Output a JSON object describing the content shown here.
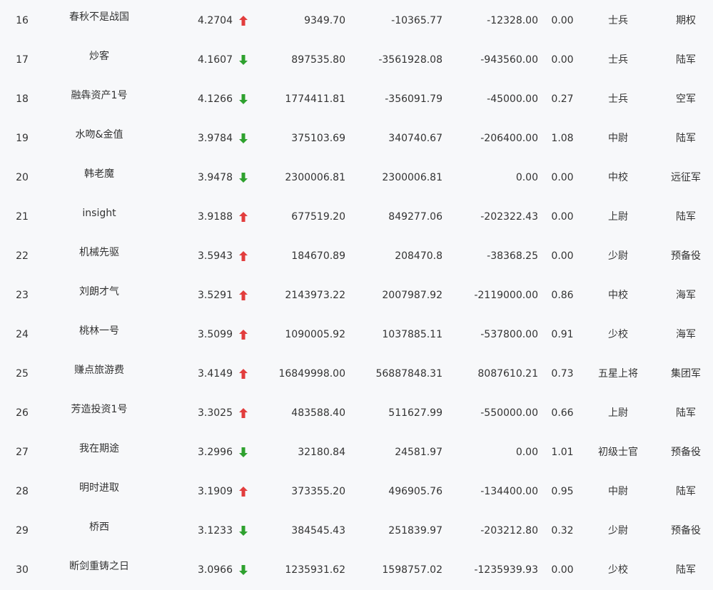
{
  "colors": {
    "up": "#e23d3d",
    "down": "#2ea12e"
  },
  "rows": [
    {
      "rank": "16",
      "name": "春秋不是战国",
      "score": "4.2704",
      "trend": "up",
      "v1": "9349.70",
      "v2": "-10365.77",
      "v3": "-12328.00",
      "v4": "0.00",
      "level": "士兵",
      "group": "期权"
    },
    {
      "rank": "17",
      "name": "炒客",
      "score": "4.1607",
      "trend": "down",
      "v1": "897535.80",
      "v2": "-3561928.08",
      "v3": "-943560.00",
      "v4": "0.00",
      "level": "士兵",
      "group": "陆军"
    },
    {
      "rank": "18",
      "name": "融犇资产1号",
      "score": "4.1266",
      "trend": "down",
      "v1": "1774411.81",
      "v2": "-356091.79",
      "v3": "-45000.00",
      "v4": "0.27",
      "level": "士兵",
      "group": "空军"
    },
    {
      "rank": "19",
      "name": "水吻&金值",
      "score": "3.9784",
      "trend": "down",
      "v1": "375103.69",
      "v2": "340740.67",
      "v3": "-206400.00",
      "v4": "1.08",
      "level": "中尉",
      "group": "陆军"
    },
    {
      "rank": "20",
      "name": "韩老魔",
      "score": "3.9478",
      "trend": "down",
      "v1": "2300006.81",
      "v2": "2300006.81",
      "v3": "0.00",
      "v4": "0.00",
      "level": "中校",
      "group": "远征军"
    },
    {
      "rank": "21",
      "name": "insight",
      "score": "3.9188",
      "trend": "up",
      "v1": "677519.20",
      "v2": "849277.06",
      "v3": "-202322.43",
      "v4": "0.00",
      "level": "上尉",
      "group": "陆军"
    },
    {
      "rank": "22",
      "name": "机械先驱",
      "score": "3.5943",
      "trend": "up",
      "v1": "184670.89",
      "v2": "208470.8",
      "v3": "-38368.25",
      "v4": "0.00",
      "level": "少尉",
      "group": "预备役"
    },
    {
      "rank": "23",
      "name": "刘朗才气",
      "score": "3.5291",
      "trend": "up",
      "v1": "2143973.22",
      "v2": "2007987.92",
      "v3": "-2119000.00",
      "v4": "0.86",
      "level": "中校",
      "group": "海军"
    },
    {
      "rank": "24",
      "name": "桃林一号",
      "score": "3.5099",
      "trend": "up",
      "v1": "1090005.92",
      "v2": "1037885.11",
      "v3": "-537800.00",
      "v4": "0.91",
      "level": "少校",
      "group": "海军"
    },
    {
      "rank": "25",
      "name": "赚点旅游费",
      "score": "3.4149",
      "trend": "up",
      "v1": "16849998.00",
      "v2": "56887848.31",
      "v3": "8087610.21",
      "v4": "0.73",
      "level": "五星上将",
      "group": "集团军"
    },
    {
      "rank": "26",
      "name": "芳造投资1号",
      "score": "3.3025",
      "trend": "up",
      "v1": "483588.40",
      "v2": "511627.99",
      "v3": "-550000.00",
      "v4": "0.66",
      "level": "上尉",
      "group": "陆军"
    },
    {
      "rank": "27",
      "name": "我在期途",
      "score": "3.2996",
      "trend": "down",
      "v1": "32180.84",
      "v2": "24581.97",
      "v3": "0.00",
      "v4": "1.01",
      "level": "初级士官",
      "group": "预备役"
    },
    {
      "rank": "28",
      "name": "明时进取",
      "score": "3.1909",
      "trend": "up",
      "v1": "373355.20",
      "v2": "496905.76",
      "v3": "-134400.00",
      "v4": "0.95",
      "level": "中尉",
      "group": "陆军"
    },
    {
      "rank": "29",
      "name": "桥西",
      "score": "3.1233",
      "trend": "down",
      "v1": "384545.43",
      "v2": "251839.97",
      "v3": "-203212.80",
      "v4": "0.32",
      "level": "少尉",
      "group": "预备役"
    },
    {
      "rank": "30",
      "name": "断剑重铸之日",
      "score": "3.0966",
      "trend": "down",
      "v1": "1235931.62",
      "v2": "1598757.02",
      "v3": "-1235939.93",
      "v4": "0.00",
      "level": "少校",
      "group": "陆军"
    }
  ]
}
